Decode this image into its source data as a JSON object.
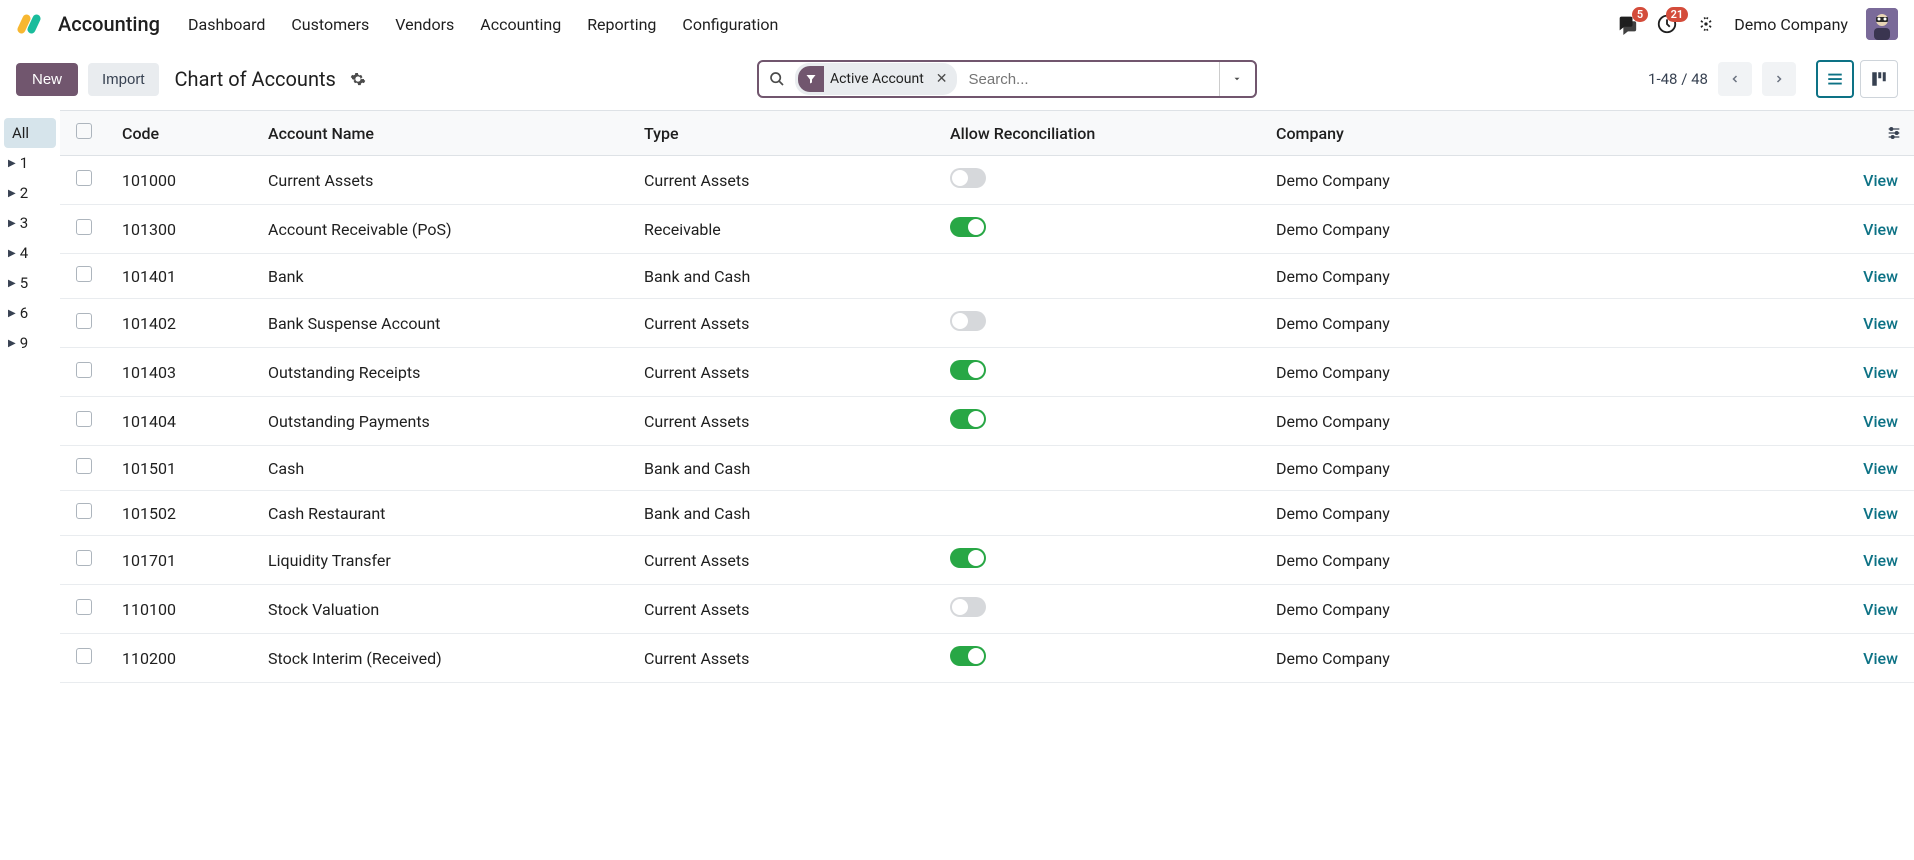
{
  "app_name": "Accounting",
  "nav": [
    "Dashboard",
    "Customers",
    "Vendors",
    "Accounting",
    "Reporting",
    "Configuration"
  ],
  "badges": {
    "messages": "5",
    "activities": "21"
  },
  "company": "Demo Company",
  "toolbar": {
    "new": "New",
    "import": "Import",
    "title": "Chart of Accounts"
  },
  "search": {
    "filter_label": "Active Account",
    "placeholder": "Search..."
  },
  "pager": "1-48 / 48",
  "sidebar": {
    "all": "All",
    "items": [
      "1",
      "2",
      "3",
      "4",
      "5",
      "6",
      "9"
    ]
  },
  "columns": {
    "code": "Code",
    "name": "Account Name",
    "type": "Type",
    "recon": "Allow Reconciliation",
    "company": "Company"
  },
  "view_label": "View",
  "rows": [
    {
      "code": "101000",
      "name": "Current Assets",
      "type": "Current Assets",
      "recon": "off",
      "company": "Demo Company"
    },
    {
      "code": "101300",
      "name": "Account Receivable (PoS)",
      "type": "Receivable",
      "recon": "on",
      "company": "Demo Company"
    },
    {
      "code": "101401",
      "name": "Bank",
      "type": "Bank and Cash",
      "recon": "none",
      "company": "Demo Company"
    },
    {
      "code": "101402",
      "name": "Bank Suspense Account",
      "type": "Current Assets",
      "recon": "off",
      "company": "Demo Company"
    },
    {
      "code": "101403",
      "name": "Outstanding Receipts",
      "type": "Current Assets",
      "recon": "on",
      "company": "Demo Company"
    },
    {
      "code": "101404",
      "name": "Outstanding Payments",
      "type": "Current Assets",
      "recon": "on",
      "company": "Demo Company"
    },
    {
      "code": "101501",
      "name": "Cash",
      "type": "Bank and Cash",
      "recon": "none",
      "company": "Demo Company"
    },
    {
      "code": "101502",
      "name": "Cash Restaurant",
      "type": "Bank and Cash",
      "recon": "none",
      "company": "Demo Company"
    },
    {
      "code": "101701",
      "name": "Liquidity Transfer",
      "type": "Current Assets",
      "recon": "on",
      "company": "Demo Company"
    },
    {
      "code": "110100",
      "name": "Stock Valuation",
      "type": "Current Assets",
      "recon": "off",
      "company": "Demo Company"
    },
    {
      "code": "110200",
      "name": "Stock Interim (Received)",
      "type": "Current Assets",
      "recon": "on",
      "company": "Demo Company"
    }
  ]
}
